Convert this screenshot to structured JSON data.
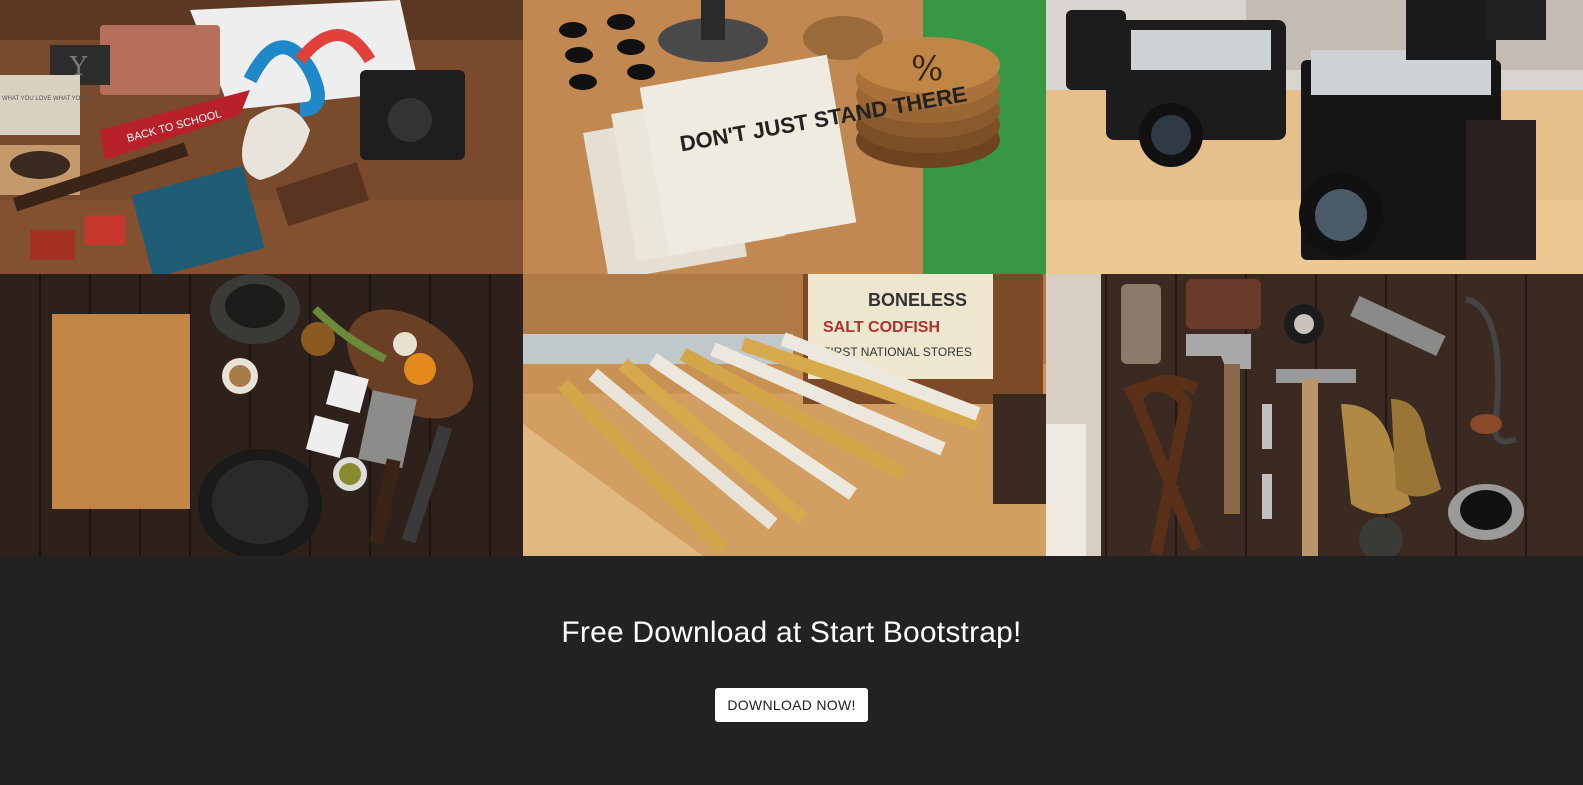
{
  "portfolio": {
    "items": [
      {
        "icon": "flatlay-desk-items-photo",
        "texts": [
          "Y",
          "WHAT YOU LOVE WHAT YOU DO",
          "BACK TO SCHOOL"
        ]
      },
      {
        "icon": "notebooks-coasters-photo",
        "texts": [
          "DON'T JUST STAND THERE",
          "%"
        ]
      },
      {
        "icon": "vintage-cameras-photo",
        "texts": []
      },
      {
        "icon": "kitchen-ingredients-photo",
        "texts": []
      },
      {
        "icon": "folding-rulers-photo",
        "texts": [
          "BONELESS",
          "SALT CODFISH",
          "FIRST NATIONAL STORES"
        ]
      },
      {
        "icon": "vintage-tools-photo",
        "texts": []
      }
    ]
  },
  "aside": {
    "heading": "Free Download at Start Bootstrap!",
    "button_label": "DOWNLOAD NOW!"
  },
  "colors": {
    "background": "#222222",
    "button_bg": "#ffffff",
    "button_text": "#222222"
  }
}
